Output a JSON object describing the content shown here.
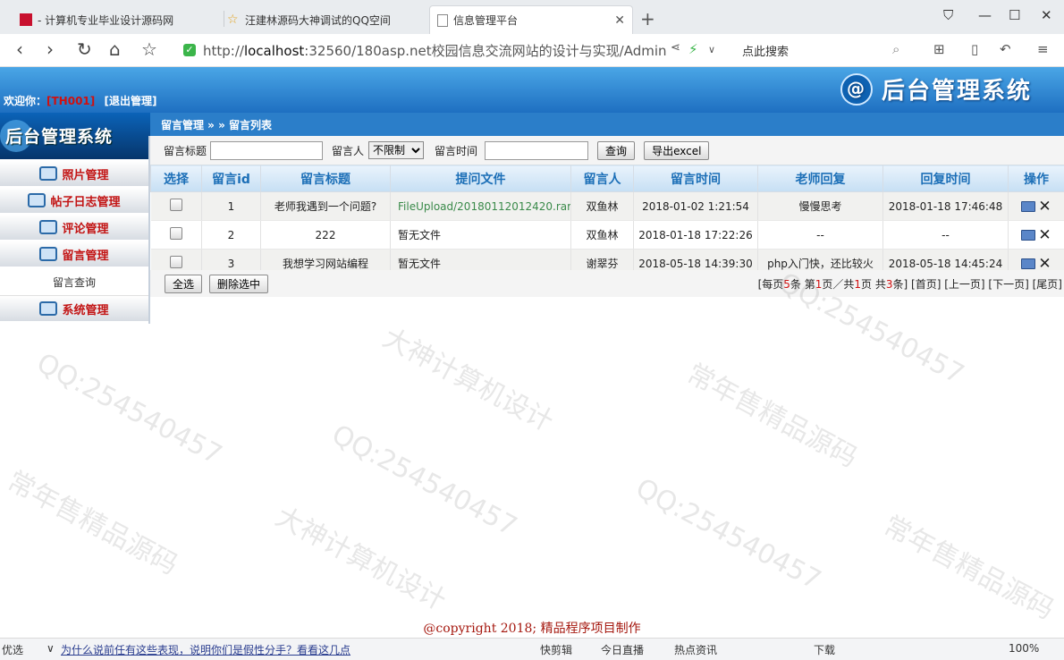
{
  "browser": {
    "tabs": [
      {
        "label": "- 计算机专业毕业设计源码网"
      },
      {
        "label": "汪建林源码大神调试的QQ空间"
      },
      {
        "label": "信息管理平台"
      }
    ],
    "url_prefix": "http://",
    "url_host": "localhost",
    "url_rest": ":32560/180asp.net校园信息交流网站的设计与实现/Admin",
    "search_placeholder": "点此搜索"
  },
  "header": {
    "system_title": "后台管理系统",
    "welcome_label": "欢迎你：",
    "username": "[TH001]",
    "logout": "[退出管理]",
    "left_title": "后台管理系统"
  },
  "breadcrumb": "留言管理 » » 留言列表",
  "sidebar": {
    "items": [
      {
        "label": "照片管理"
      },
      {
        "label": "帖子日志管理"
      },
      {
        "label": "评论管理"
      },
      {
        "label": "留言管理"
      },
      {
        "label": "留言查询"
      },
      {
        "label": "系统管理"
      }
    ]
  },
  "filter": {
    "title_label": "留言标题",
    "author_label": "留言人",
    "author_selected": "不限制",
    "time_label": "留言时间",
    "query_button": "查询",
    "export_button": "导出excel"
  },
  "table": {
    "headers": [
      "选择",
      "留言id",
      "留言标题",
      "提问文件",
      "留言人",
      "留言时间",
      "老师回复",
      "回复时间",
      "操作"
    ],
    "rows": [
      {
        "id": "1",
        "title": "老师我遇到一个问题?",
        "file": "FileUpload/20180112012420.rar",
        "author": "双鱼林",
        "time": "2018-01-02 1:21:54",
        "reply": "慢慢思考",
        "reply_time": "2018-01-18 17:46:48"
      },
      {
        "id": "2",
        "title": "222",
        "file": "暂无文件",
        "author": "双鱼林",
        "time": "2018-01-18 17:22:26",
        "reply": "--",
        "reply_time": "--"
      },
      {
        "id": "3",
        "title": "我想学习网站编程",
        "file": "暂无文件",
        "author": "谢翠芬",
        "time": "2018-05-18 14:39:30",
        "reply": "php入门快，还比较火",
        "reply_time": "2018-05-18 14:45:24"
      }
    ]
  },
  "footer": {
    "select_all": "全选",
    "delete_selected": "删除选中",
    "pager_prefix": "[每页",
    "per_page": "5",
    "pager_mid1": "条 第",
    "current_page": "1",
    "pager_mid2": "页／共",
    "total_pages": "1",
    "pager_mid3": "页 共",
    "total_records": "3",
    "pager_suffix": "条]",
    "first": "[首页]",
    "prev": "[上一页]",
    "next": "[下一页]",
    "last": "[尾页]"
  },
  "copyright": "@copyright 2018; 精品程序项目制作",
  "statusbar": {
    "left": "优选",
    "news": "为什么说前任有这些表现，说明你们是假性分手？看看这几点",
    "items": [
      "快剪辑",
      "今日直播",
      "热点资讯",
      "下载",
      "100%"
    ]
  },
  "watermark": {
    "lines": [
      "QQ:254540457",
      "大神计算机设计",
      "常年售精品源码"
    ]
  }
}
